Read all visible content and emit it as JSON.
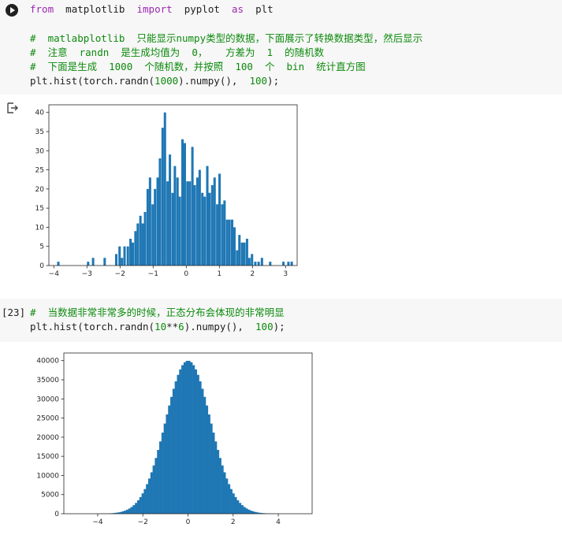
{
  "cell1": {
    "code_line1": {
      "kw1": "from",
      "mod": "matplotlib",
      "kw2": "import",
      "sub": "pyplot",
      "kw3": "as",
      "alias": "plt"
    },
    "comment1": "#  matlabplotlib  只能显示numpy类型的数据，下面展示了转换数据类型，然后显示",
    "comment2": "#  注意  randn  是生成均值为  0，   方差为  1  的随机数",
    "comment3": "#  下面是生成  1000  个随机数，并按照  100  个  bin  统计直方图",
    "code_pre": "plt.hist(torch.randn(",
    "code_num1": "1000",
    "code_mid": ").numpy(),  ",
    "code_num2": "100",
    "code_post": ");"
  },
  "cell2": {
    "exec_count": "[23]",
    "comment": "#  当数据非常非常多的时候，正态分布会体现的非常明显",
    "code_pre": "plt.hist(torch.randn(",
    "code_num1": "10",
    "code_op": "**",
    "code_num2": "6",
    "code_mid": ").numpy(),  ",
    "code_num3": "100",
    "code_post": ");"
  },
  "colors": {
    "bar": "#1f77b4",
    "comment": "#0d8a0d",
    "keyword": "#9c27b0",
    "cell_bg": "#f7f7f7"
  },
  "icons": {
    "run": "play-circle-icon",
    "output": "output-arrow-icon"
  },
  "chart_data": [
    {
      "type": "bar",
      "description_of_data": "histogram of 1000 standard normal samples, 100 bins",
      "xlim": [
        -4.15,
        3.35
      ],
      "ylim": [
        0,
        42
      ],
      "xticks": [
        -4,
        -3,
        -2,
        -1,
        0,
        1,
        2,
        3
      ],
      "yticks": [
        0,
        5,
        10,
        15,
        20,
        25,
        30,
        35,
        40
      ],
      "bin_width": 0.072,
      "x": [
        -3.9,
        -3.0,
        -2.85,
        -2.5,
        -2.15,
        -2.05,
        -1.98,
        -1.9,
        -1.8,
        -1.72,
        -1.65,
        -1.57,
        -1.5,
        -1.42,
        -1.35,
        -1.28,
        -1.2,
        -1.13,
        -1.05,
        -0.98,
        -0.9,
        -0.83,
        -0.75,
        -0.68,
        -0.6,
        -0.53,
        -0.45,
        -0.38,
        -0.3,
        -0.23,
        -0.15,
        -0.08,
        0.0,
        0.07,
        0.15,
        0.22,
        0.3,
        0.37,
        0.45,
        0.52,
        0.6,
        0.67,
        0.75,
        0.82,
        0.9,
        0.97,
        1.05,
        1.12,
        1.2,
        1.27,
        1.35,
        1.42,
        1.5,
        1.57,
        1.65,
        1.72,
        1.8,
        1.87,
        1.95,
        2.05,
        2.15,
        2.25,
        2.5,
        2.9,
        3.05,
        3.15
      ],
      "values": [
        1,
        1,
        2,
        2,
        3,
        5,
        2,
        5,
        5,
        7,
        6,
        9,
        11,
        13,
        11,
        14,
        20,
        23,
        16,
        20,
        23,
        28,
        36,
        40,
        22,
        29,
        19,
        26,
        23,
        18,
        33,
        32,
        22,
        22,
        31,
        21,
        23,
        25,
        19,
        18,
        26,
        19,
        21,
        23,
        16,
        24,
        16,
        17,
        12,
        12,
        12,
        10,
        4,
        8,
        6,
        6,
        7,
        2,
        3,
        1,
        1,
        2,
        1,
        1,
        1,
        1
      ]
    },
    {
      "type": "bar",
      "description_of_data": "histogram of 10**6 standard normal samples, 100 bins",
      "xlim": [
        -5.5,
        5.5
      ],
      "ylim": [
        0,
        42000
      ],
      "xticks": [
        -4,
        -2,
        0,
        2,
        4
      ],
      "yticks": [
        0,
        5000,
        10000,
        15000,
        20000,
        25000,
        30000,
        35000,
        40000
      ],
      "peak": 40000,
      "mean": 0,
      "std": 1
    }
  ]
}
